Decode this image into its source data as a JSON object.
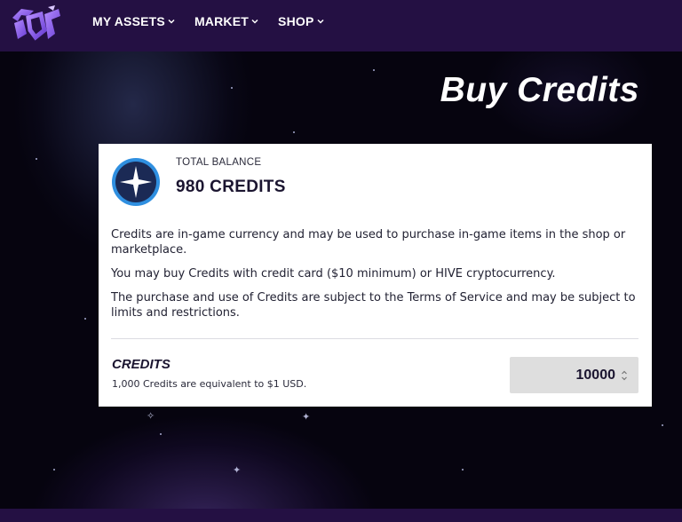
{
  "header": {
    "nav": [
      {
        "label": "MY ASSETS"
      },
      {
        "label": "MARKET"
      },
      {
        "label": "SHOP"
      }
    ]
  },
  "page": {
    "title": "Buy Credits"
  },
  "balance": {
    "label": "TOTAL BALANCE",
    "value": "980 CREDITS"
  },
  "description": {
    "p1": "Credits are in-game currency and may be used to purchase in-game items in the shop or marketplace.",
    "p2": "You may buy Credits with credit card ($10 minimum) or HIVE cryptocurrency.",
    "p3": "The purchase and use of Credits are subject to the Terms of Service and may be subject to limits and restrictions."
  },
  "purchase": {
    "title": "CREDITS",
    "note": "1,000 Credits are equivalent to $1 USD.",
    "quantity": "10000"
  },
  "colors": {
    "header_bg": "#241043",
    "accent_purple": "#7b4fe0",
    "badge_blue": "#2f8fe0",
    "badge_navy": "#1b2a55"
  },
  "icons": {
    "logo": "splinterlands-logo",
    "chevron": "chevron-down-icon",
    "badge": "credits-star-icon",
    "spinner": "number-spinner-icon"
  }
}
